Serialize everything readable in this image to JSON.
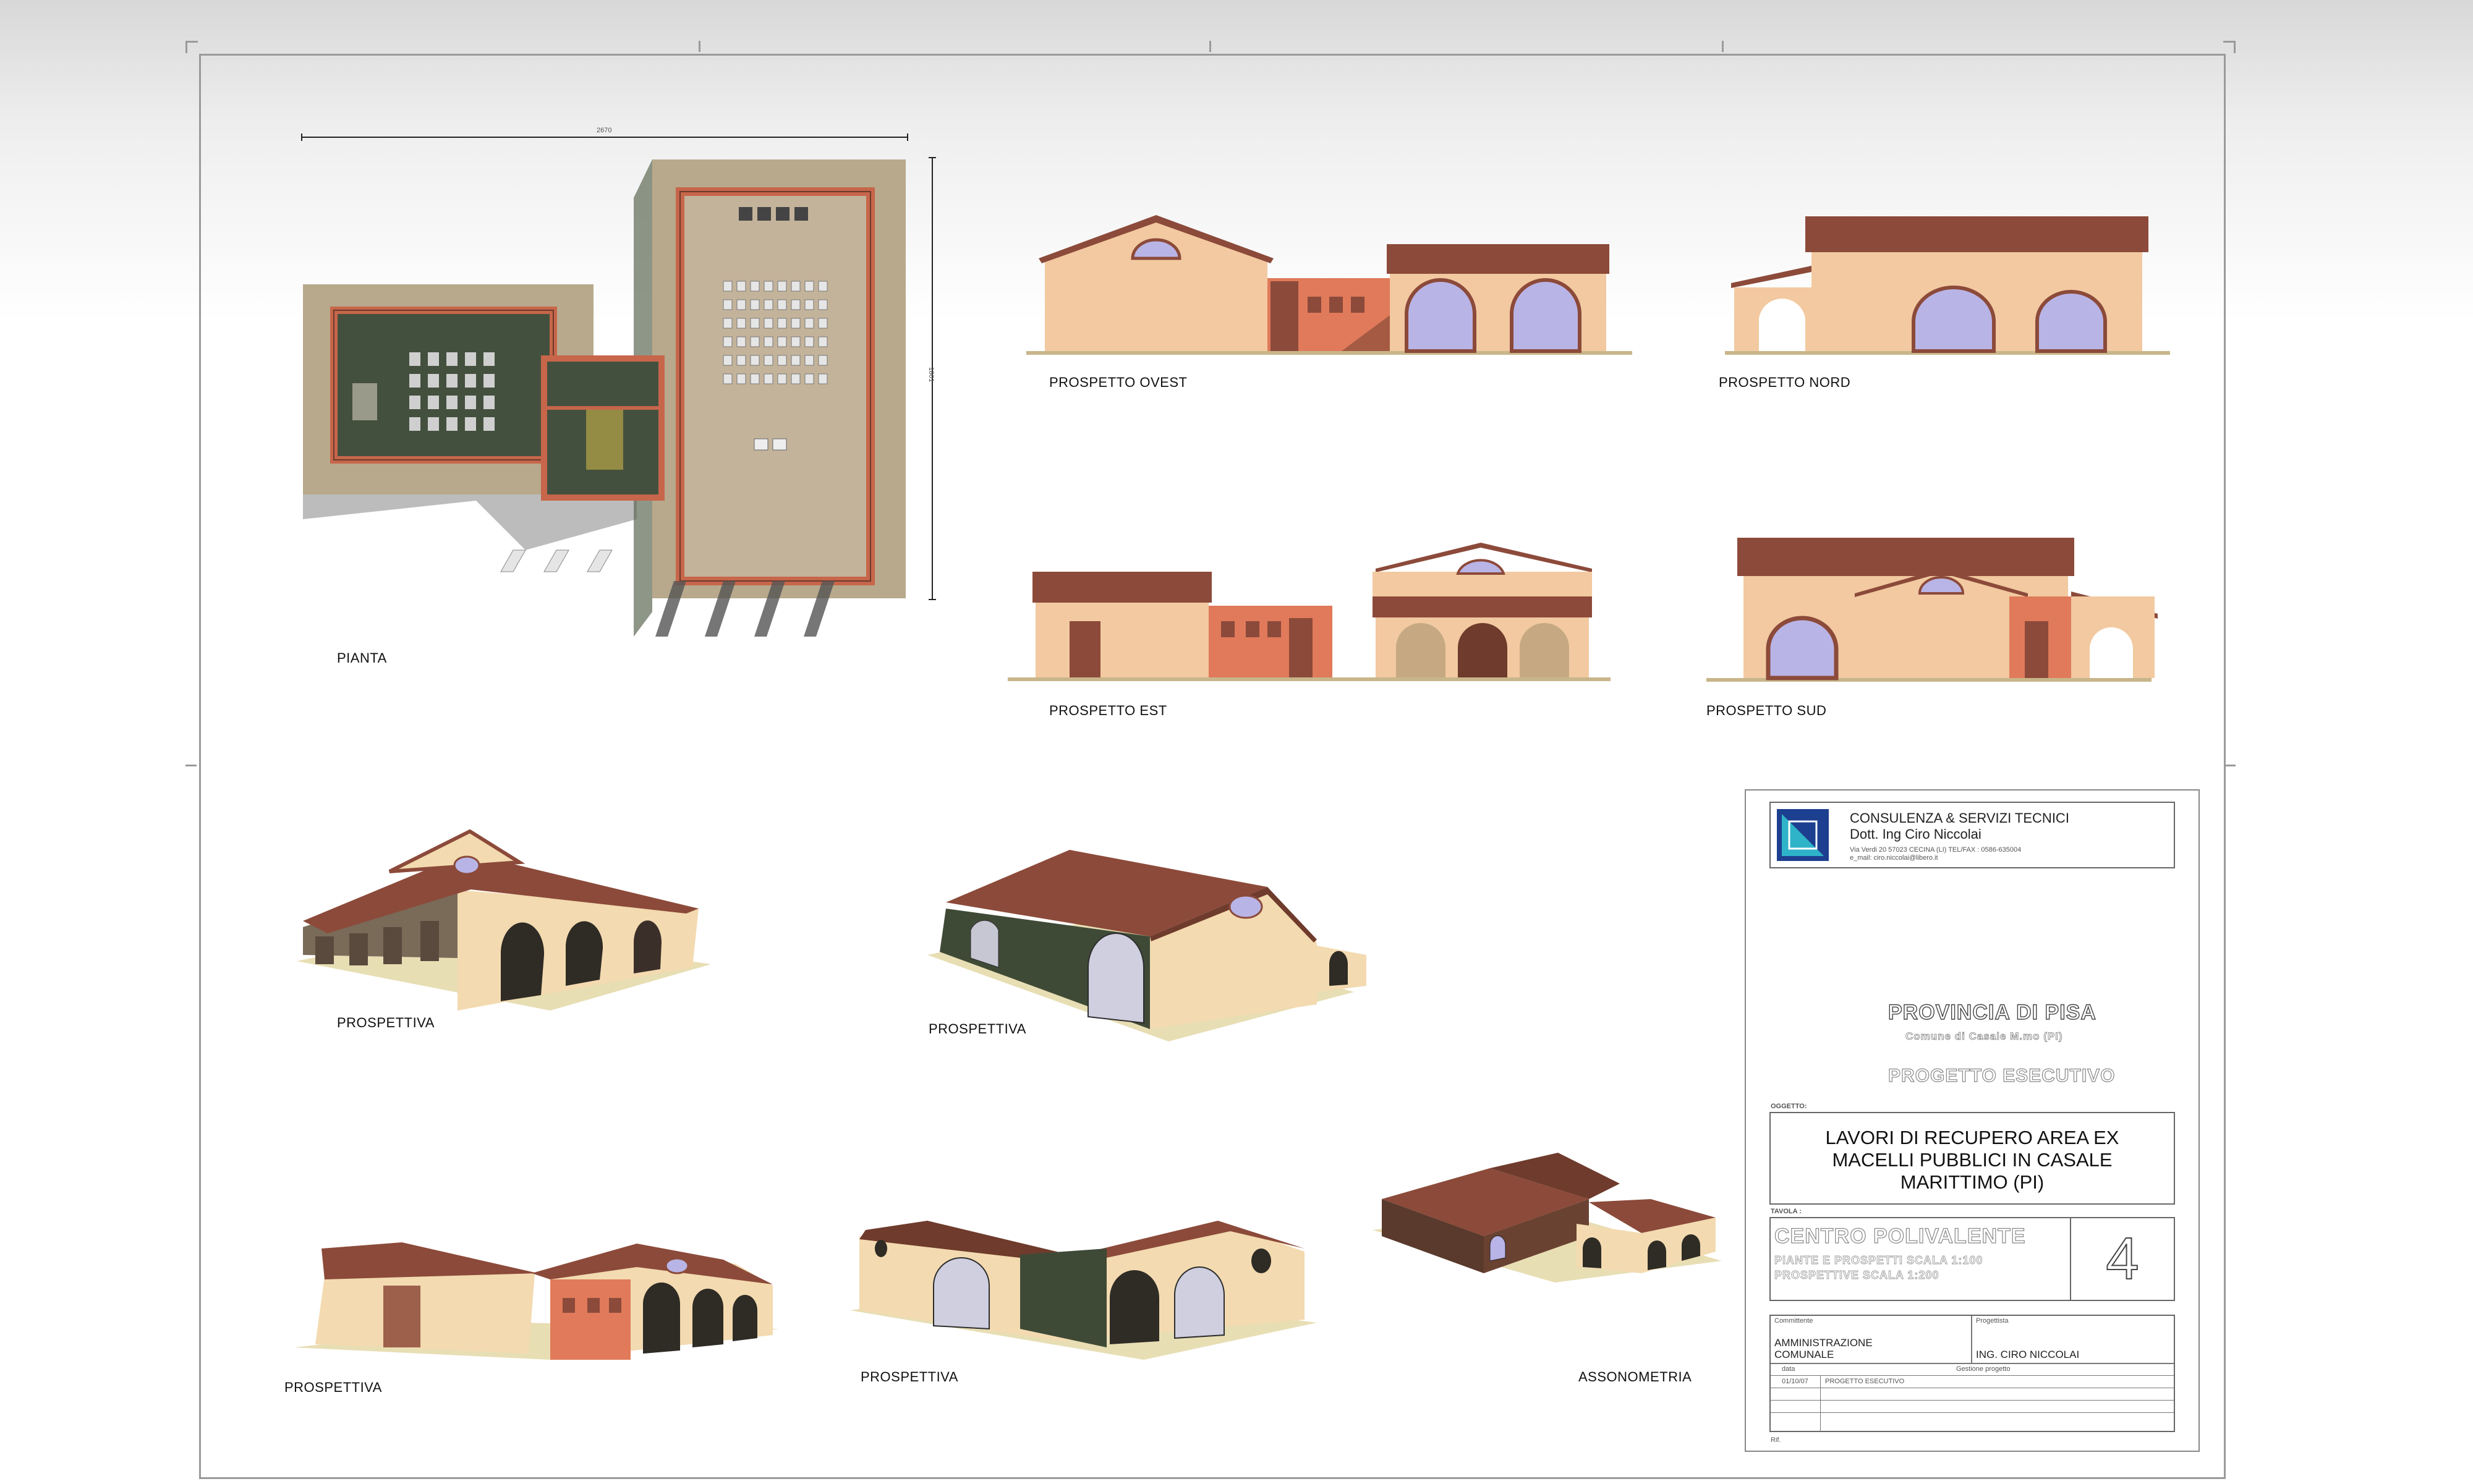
{
  "plan": {
    "label": "PIANTA",
    "dim_top": "2670",
    "dim_side": "1801"
  },
  "elevations": {
    "ovest": "PROSPETTO OVEST",
    "nord": "PROSPETTO NORD",
    "est": "PROSPETTO EST",
    "sud": "PROSPETTO SUD"
  },
  "views": {
    "p1": "PROSPETTIVA",
    "p2": "PROSPETTIVA",
    "p3": "PROSPETTIVA",
    "p4": "PROSPETTIVA",
    "axon": "ASSONOMETRIA"
  },
  "title_block": {
    "firm_name": "CONSULENZA & SERVIZI TECNICI",
    "firm_person": "Dott. Ing Ciro Niccolai",
    "firm_address": "Via Verdi 20 57023 CECINA (LI) TEL/FAX : 0586-635004",
    "firm_email": "e_mail: ciro.niccolai@libero.it",
    "province": "PROVINCIA DI PISA",
    "municipality": "Comune di Casale M.mo (PI)",
    "phase": "PROGETTO ESECUTIVO",
    "oggetto_label": "OGGETTO:",
    "oggetto_line1": "LAVORI  DI RECUPERO  AREA EX",
    "oggetto_line2": "MACELLI PUBBLICI IN CASALE",
    "oggetto_line3": "MARITTIMO (PI)",
    "tavola_label": "TAVOLA :",
    "tavola_title": "CENTRO POLIVALENTE",
    "tavola_sub1": "PIANTE E PROSPETTI  SCALA 1:100",
    "tavola_sub2": "PROSPETTIVE SCALA 1:200",
    "tavola_number": "4",
    "committente_label": "Committente",
    "committente_line1": "AMMINISTRAZIONE",
    "committente_line2": "COMUNALE",
    "progettista_label": "Progettista",
    "progettista": "ING. CIRO NICCOLAI",
    "data_label": "data",
    "gestione_label": "Gestione progetto",
    "date": "01/10/07",
    "revision_text": "PROGETTO ESECUTIVO",
    "file_label": "Rif."
  },
  "colors": {
    "roof": "#8c4a3a",
    "wall": "#f0cfa6",
    "wall_dark": "#3f4a36",
    "accent_wall": "#e07a5a",
    "glass": "#b9b4e6",
    "ground": "#d9cba0",
    "logo_blue": "#1d3f8f",
    "logo_cyan": "#2fb3c9"
  }
}
